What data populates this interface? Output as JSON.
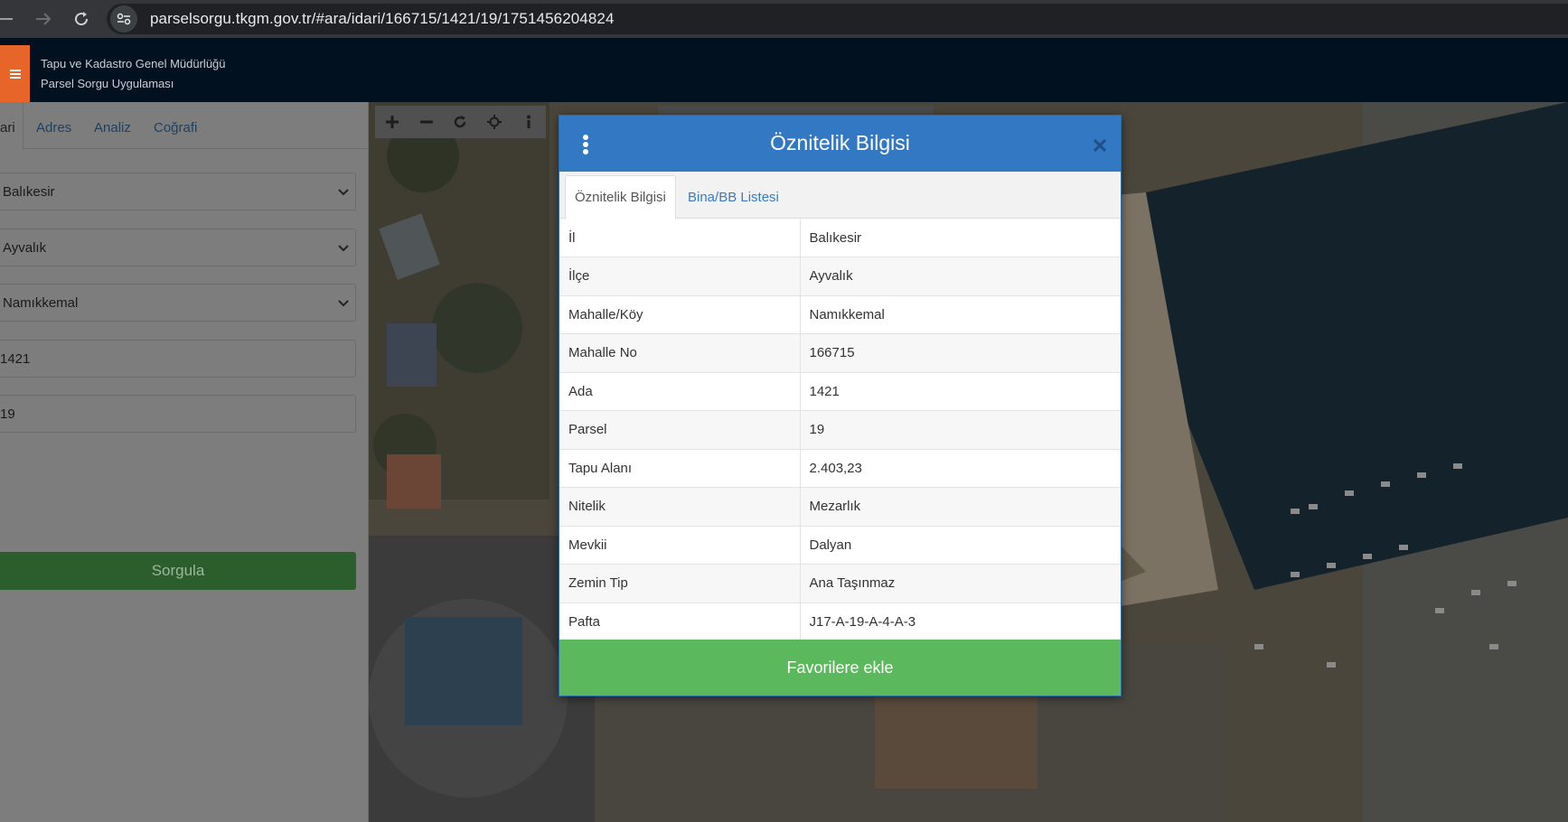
{
  "browser": {
    "url": "parselsorgu.tkgm.gov.tr/#ara/idari/166715/1421/19/1751456204824"
  },
  "header": {
    "title_line1": "Tapu ve Kadastro Genel Müdürlüğü",
    "title_line2": "Parsel Sorgu Uygulaması"
  },
  "sidebar": {
    "tabs": [
      "ari",
      "Adres",
      "Analiz",
      "Coğrafi"
    ],
    "province": "Balıkesir",
    "district": "Ayvalık",
    "neighborhood": "Namıkkemal",
    "block": "1421",
    "parcel": "19",
    "query_button": "Sorgula"
  },
  "map": {
    "tools": [
      "zoom-in",
      "zoom-out",
      "refresh",
      "locate",
      "info"
    ]
  },
  "modal": {
    "title": "Öznitelik Bilgisi",
    "tabs": {
      "active": "Öznitelik Bilgisi",
      "other": "Bina/BB Listesi"
    },
    "rows": [
      {
        "key": "İl",
        "value": "Balıkesir"
      },
      {
        "key": "İlçe",
        "value": "Ayvalık"
      },
      {
        "key": "Mahalle/Köy",
        "value": "Namıkkemal"
      },
      {
        "key": "Mahalle No",
        "value": "166715"
      },
      {
        "key": "Ada",
        "value": "1421"
      },
      {
        "key": "Parsel",
        "value": "19"
      },
      {
        "key": "Tapu Alanı",
        "value": "2.403,23"
      },
      {
        "key": "Nitelik",
        "value": "Mezarlık"
      },
      {
        "key": "Mevkii",
        "value": "Dalyan"
      },
      {
        "key": "Zemin Tip",
        "value": "Ana Taşınmaz"
      },
      {
        "key": "Pafta",
        "value": "J17-A-19-A-4-A-3"
      }
    ],
    "favorite_button": "Favorilere ekle"
  },
  "colors": {
    "modal_header": "#3278c2",
    "favorite_button": "#5cb85c",
    "app_header": "#01111f",
    "menu_accent": "#e8652a"
  }
}
